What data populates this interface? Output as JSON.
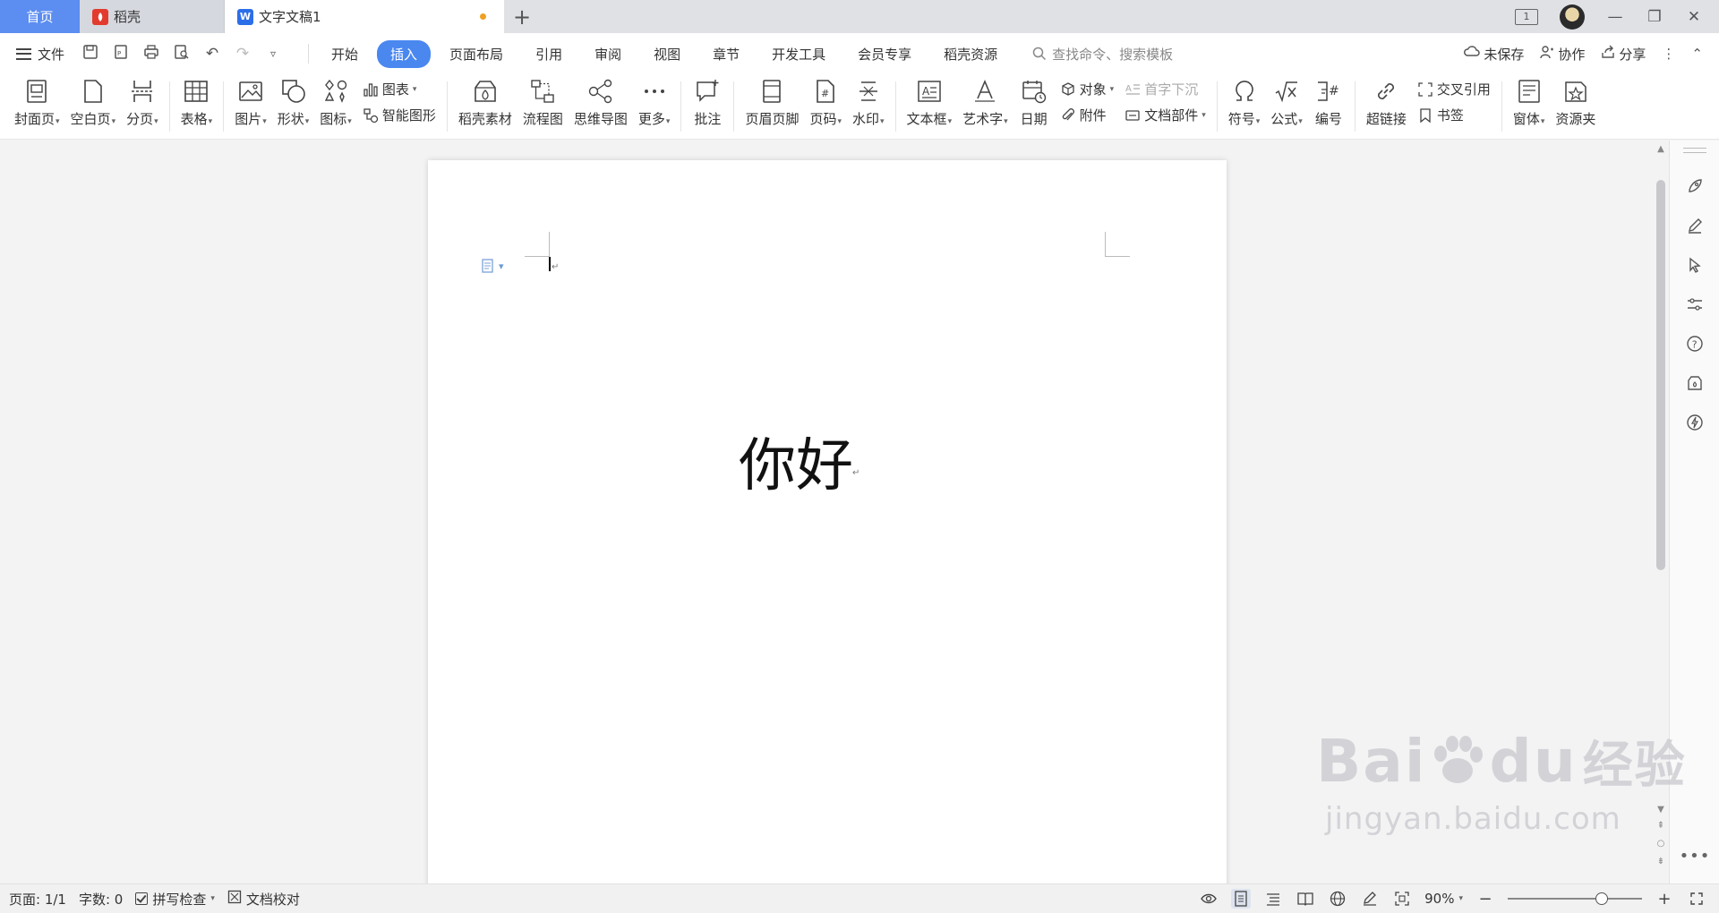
{
  "tabbar": {
    "home_label": "首页",
    "tabs": [
      {
        "label": "稻壳",
        "icon": "daoke-icon"
      },
      {
        "label": "文字文稿1",
        "icon": "wps-writer-icon",
        "unsaved": true
      }
    ],
    "page_indicator": "1"
  },
  "menubar": {
    "file_label": "文件",
    "tabs": [
      "开始",
      "插入",
      "页面布局",
      "引用",
      "审阅",
      "视图",
      "章节",
      "开发工具",
      "会员专享",
      "稻壳资源"
    ],
    "active_tab": "插入",
    "search_placeholder": "查找命令、搜索模板",
    "right": {
      "unsaved": "未保存",
      "collab": "协作",
      "share": "分享"
    }
  },
  "ribbon": {
    "cover": "封面页",
    "blank": "空白页",
    "pagebreak": "分页",
    "table": "表格",
    "picture": "图片",
    "shape": "形状",
    "icons": "图标",
    "chart": "图表",
    "smartart": "智能图形",
    "daoke_material": "稻壳素材",
    "flowchart": "流程图",
    "mindmap": "思维导图",
    "more": "更多",
    "comment": "批注",
    "header_footer": "页眉页脚",
    "page_number": "页码",
    "watermark": "水印",
    "textbox": "文本框",
    "wordart": "艺术字",
    "date": "日期",
    "object": "对象",
    "dropcap": "首字下沉",
    "attachment": "附件",
    "doc_parts": "文档部件",
    "symbol": "符号",
    "formula": "公式",
    "numbering": "编号",
    "hyperlink": "超链接",
    "crossref": "交叉引用",
    "bookmark": "书签",
    "form": "窗体",
    "resource": "资源夹"
  },
  "document": {
    "body_text": "你好",
    "para_mark": "↵"
  },
  "statusbar": {
    "page": "页面: 1/1",
    "words": "字数: 0",
    "spellcheck": "拼写检查",
    "proofread": "文档校对",
    "zoom": "90%",
    "zoom_level": 0.72
  },
  "watermark": {
    "brand": "Bai",
    "brand2": "du",
    "suffix": "经验",
    "url": "jingyan.baidu.com"
  },
  "colors": {
    "accent": "#4a88f0",
    "home_tab": "#5c8df0",
    "unsaved_dot": "#f0a020"
  }
}
